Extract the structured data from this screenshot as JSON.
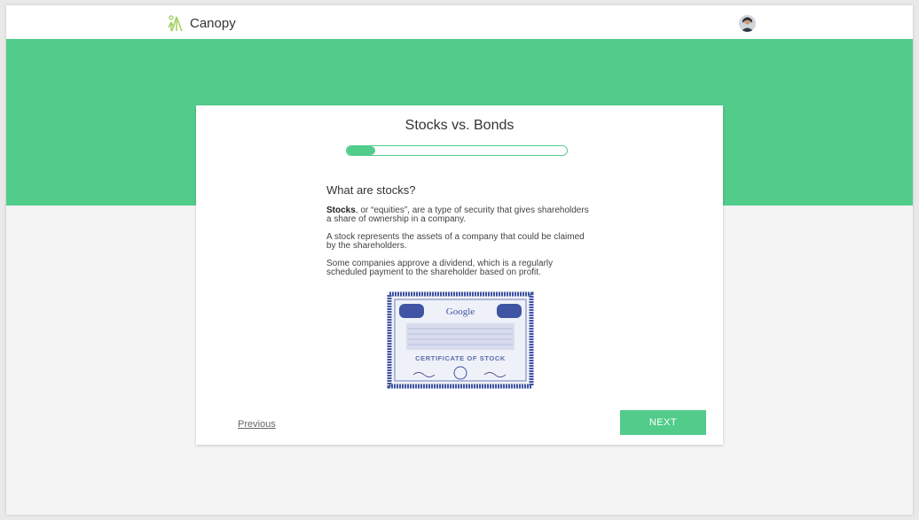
{
  "app": {
    "name": "Canopy"
  },
  "colors": {
    "accent": "#52cc8b",
    "background": "#f4f4f4"
  },
  "lesson": {
    "title": "Stocks vs. Bonds",
    "progress_fraction": 0.13,
    "heading": "What are stocks?",
    "paragraph1_bold": "Stocks",
    "paragraph1_rest": ", or “equities”, are a type of security that gives shareholders a share of ownership in a company.",
    "paragraph2": "A stock represents the assets of a company that could be claimed by the shareholders.",
    "paragraph3": "Some companies approve a dividend, which is a regularly scheduled payment to the shareholder based on profit.",
    "image": {
      "brand": "Google",
      "caption": "CERTIFICATE OF STOCK"
    }
  },
  "nav": {
    "previous_label": "Previous",
    "next_label": "NEXT"
  },
  "icons": {
    "logo": "tree-logo-icon",
    "avatar": "user-avatar"
  }
}
